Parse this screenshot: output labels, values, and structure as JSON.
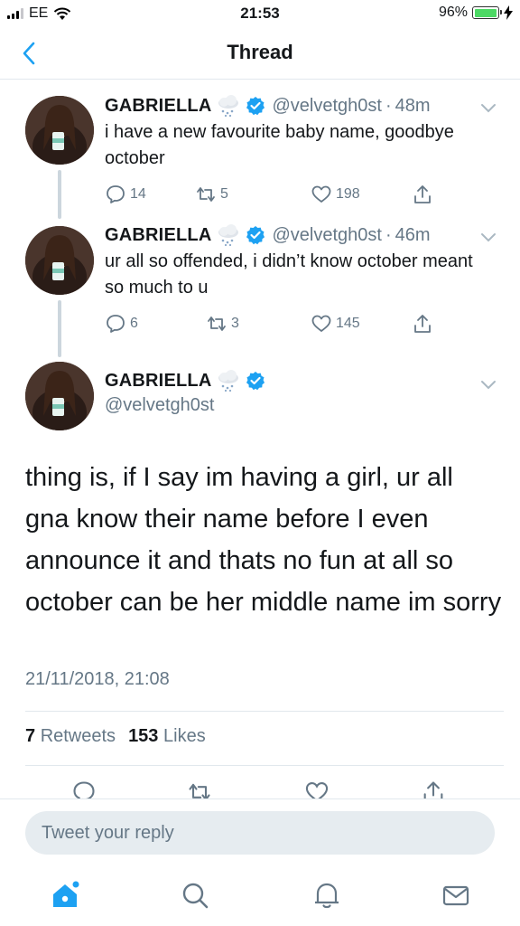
{
  "status_bar": {
    "carrier": "EE",
    "time": "21:53",
    "battery_percent": "96%",
    "battery_level": 0.96
  },
  "nav": {
    "title": "Thread",
    "back_icon": "chevron-left-icon"
  },
  "thread": [
    {
      "name": "GABRIELLA",
      "handle": "@velvetgh0st",
      "time": "48m",
      "text": "i have a new favourite baby name, goodbye october",
      "replies": "14",
      "retweets": "5",
      "likes": "198"
    },
    {
      "name": "GABRIELLA",
      "handle": "@velvetgh0st",
      "time": "46m",
      "text": "ur all so offended, i didn’t know october meant so much to u",
      "replies": "6",
      "retweets": "3",
      "likes": "145"
    }
  ],
  "main_tweet": {
    "name": "GABRIELLA",
    "handle": "@velvetgh0st",
    "text": "thing is, if I say im having a girl, ur all gna know their name before I even announce it and thats no fun at all so october can be her middle name im sorry",
    "date": "21/11/2018, 21:08",
    "retweets_count": "7",
    "retweets_label": "Retweets",
    "likes_count": "153",
    "likes_label": "Likes"
  },
  "reply": {
    "placeholder": "Tweet your reply"
  },
  "tabs": [
    "home-icon",
    "search-icon",
    "notifications-icon",
    "messages-icon"
  ],
  "colors": {
    "accent": "#1da1f2",
    "muted": "#657786",
    "divider": "#e1e8ed",
    "battery": "#4cd964"
  }
}
